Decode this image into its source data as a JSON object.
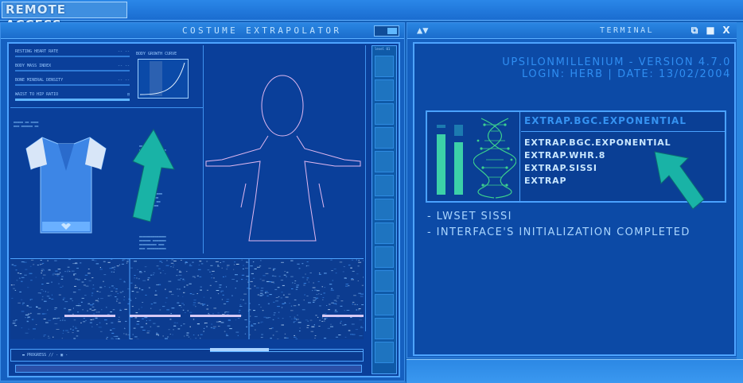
{
  "top_bar": {
    "title": "REMOTE ACCESS"
  },
  "costume_window": {
    "title": "COSTUME EXTRAPOLATOR",
    "stats": [
      {
        "label": "RESTING HEART RATE",
        "dash": "-- --"
      },
      {
        "label": "BODY MASS INDEX",
        "dash": "-- --"
      },
      {
        "label": "BONE MINERAL DENSITY",
        "dash": "-- --"
      },
      {
        "label": "WAIST TO HIP RATIO",
        "dash": "▤"
      }
    ],
    "curve_title": "BODY GROWTH CURVE",
    "side_label": "level 01",
    "progress_label": "▬ PROGRESS // - ▣ -"
  },
  "terminal_window": {
    "title": "TERMINAL",
    "nav_arrows": "▲▼",
    "controls": {
      "restore": "⧉",
      "minimize": "■",
      "close": "X"
    },
    "version_line": "UPSILONMILLENIUM - VERSION 4.7.0",
    "login_line": "LOGIN: HERB | DATE: 13/02/2004",
    "extrap_header": "EXTRAP.BGC.EXPONENTIAL",
    "extrap_items": [
      "EXTRAP.BGC.EXPONENTIAL",
      "EXTRAP.WHR.8",
      "EXTRAP.SISSI",
      "EXTRAP"
    ],
    "log_lines": [
      "- LWSET SISSI",
      "- INTERFACE'S INITIALIZATION COMPLETED"
    ]
  },
  "colors": {
    "background": "#1460b8",
    "panel": "#0a3f9a",
    "accent": "#4ea4ff",
    "arrow": "#19b3a6",
    "bars": "#3cd0a8"
  }
}
